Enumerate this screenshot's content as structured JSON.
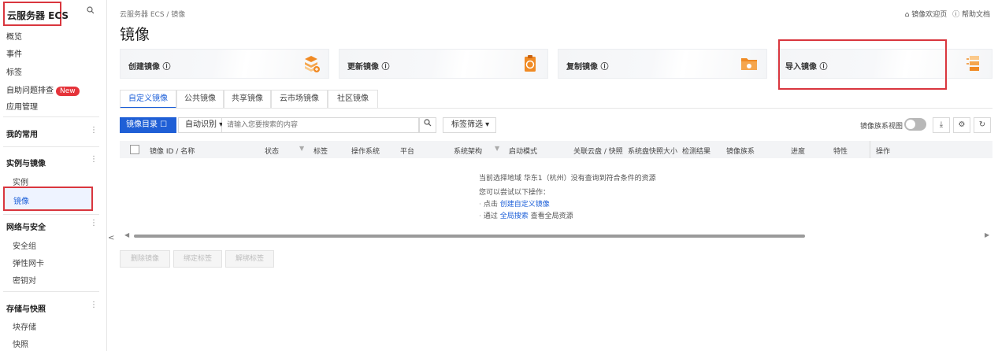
{
  "sidebar": {
    "title": "云服务器 ECS",
    "search_icon": "search-icon",
    "items": [
      {
        "label": "概览"
      },
      {
        "label": "事件"
      },
      {
        "label": "标签"
      },
      {
        "label": "自助问题排查",
        "badge": "New"
      },
      {
        "label": "应用管理"
      }
    ],
    "groups": [
      {
        "label": "我的常用",
        "items": []
      },
      {
        "label": "实例与镜像",
        "items": [
          "实例",
          "镜像"
        ]
      },
      {
        "label": "网络与安全",
        "items": [
          "安全组",
          "弹性网卡",
          "密钥对"
        ]
      },
      {
        "label": "存储与快照",
        "items": [
          "块存储",
          "快照"
        ]
      }
    ],
    "active_item": "镜像",
    "collapse_glyph": "<"
  },
  "header": {
    "breadcrumb": "云服务器 ECS / 镜像",
    "welcome_link": "镜像欢迎页",
    "help_link": "帮助文档",
    "title": "镜像"
  },
  "cards": [
    {
      "label": "创建镜像 ⓘ",
      "icon": "create-image-illustration"
    },
    {
      "label": "更新镜像 ⓘ",
      "icon": "update-image-illustration"
    },
    {
      "label": "复制镜像 ⓘ",
      "icon": "copy-image-illustration"
    },
    {
      "label": "导入镜像 ⓘ",
      "icon": "import-image-illustration"
    }
  ],
  "tabs": [
    {
      "label": "自定义镜像",
      "active": true
    },
    {
      "label": "公共镜像"
    },
    {
      "label": "共享镜像"
    },
    {
      "label": "云市场镜像"
    },
    {
      "label": "社区镜像"
    }
  ],
  "toolbar": {
    "catalog_button": "镜像目录 ☐",
    "filter_select": "自动识别 ▾",
    "search_placeholder": "请输入您要搜索的内容",
    "tag_filter": "标签筛选 ▾",
    "family_view_label": "镜像族系视图",
    "family_view_on": false
  },
  "table": {
    "columns": [
      "镜像 ID / 名称",
      "状态",
      "标签",
      "操作系统",
      "平台",
      "系统架构",
      "启动模式",
      "关联云盘 / 快照",
      "系统盘快照大小",
      "检测结果",
      "镜像族系",
      "进度",
      "特性",
      "操作"
    ],
    "rows": []
  },
  "empty_state": {
    "line1": "当前选择地域 华东1（杭州）没有查询到符合条件的资源",
    "line2": "您可以尝试以下操作：",
    "line3_prefix": "点击",
    "line3_link": "创建自定义镜像",
    "line4_prefix": "通过",
    "line4_link": "全局搜索",
    "line4_suffix": "查看全局资源"
  },
  "bulk_actions": [
    "删除镜像",
    "绑定标签",
    "解绑标签"
  ],
  "colors": {
    "primary": "#1f5fd6",
    "highlight_border": "#d9363e",
    "badge_red": "#e5333a"
  }
}
